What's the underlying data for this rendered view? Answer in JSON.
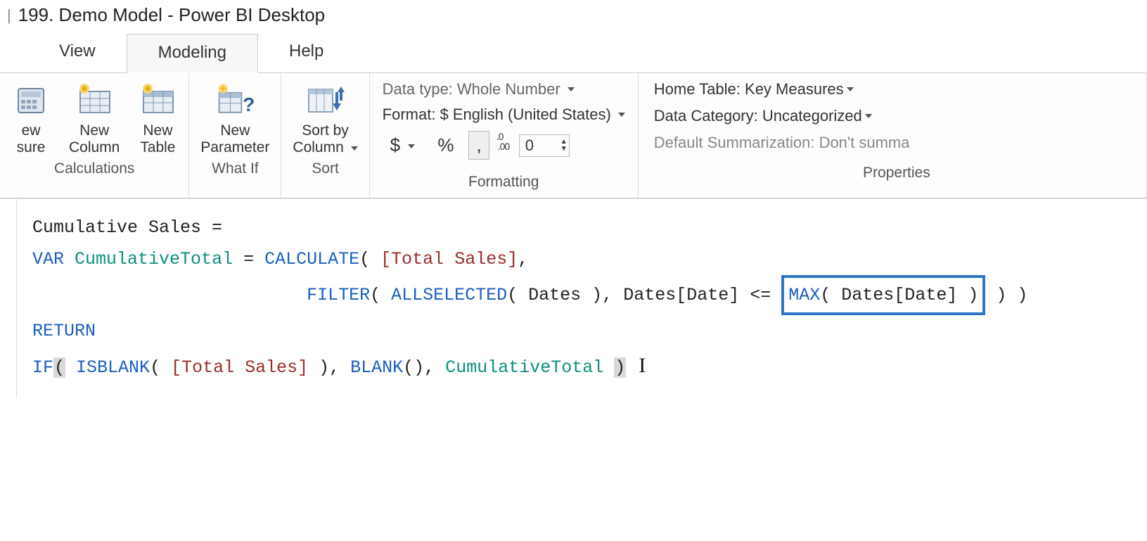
{
  "window": {
    "title": "199. Demo Model - Power BI Desktop"
  },
  "tabs": {
    "view": "View",
    "modeling": "Modeling",
    "help": "Help",
    "active": "modeling"
  },
  "ribbon": {
    "calculations": {
      "group_label": "Calculations",
      "new_measure_line1": "ew",
      "new_measure_line2": "sure",
      "new_column_line1": "New",
      "new_column_line2": "Column",
      "new_table_line1": "New",
      "new_table_line2": "Table"
    },
    "whatif": {
      "group_label": "What If",
      "new_parameter_line1": "New",
      "new_parameter_line2": "Parameter"
    },
    "sort": {
      "group_label": "Sort",
      "sort_by_line1": "Sort by",
      "sort_by_line2": "Column"
    },
    "formatting": {
      "group_label": "Formatting",
      "data_type_label": "Data type:",
      "data_type_value": "Whole Number",
      "format_label": "Format:",
      "format_value": "$ English (United States)",
      "currency_symbol": "$",
      "percent_symbol": "%",
      "thousands_symbol": ",",
      "decimal_icon": ".0 0",
      "decimals_value": "0"
    },
    "properties": {
      "group_label": "Properties",
      "home_table_label": "Home Table:",
      "home_table_value": "Key Measures",
      "data_category_label": "Data Category:",
      "data_category_value": "Uncategorized",
      "default_summ_label": "Default Summarization:",
      "default_summ_value": "Don't summa"
    }
  },
  "formula": {
    "line1_name": "Cumulative Sales",
    "eq": " = ",
    "var_kw": "VAR",
    "var_name": "CumulativeTotal",
    "calc": "CALCULATE",
    "total_sales": "[Total Sales]",
    "filter": "FILTER",
    "allselected": "ALLSELECTED",
    "dates_tbl": "Dates",
    "dates_col": "Dates[Date]",
    "lte": "<=",
    "max": "MAX",
    "return_kw": "RETURN",
    "if_kw": "IF",
    "isblank": "ISBLANK",
    "blank": "BLANK",
    "cumulative_ref": "CumulativeTotal"
  }
}
